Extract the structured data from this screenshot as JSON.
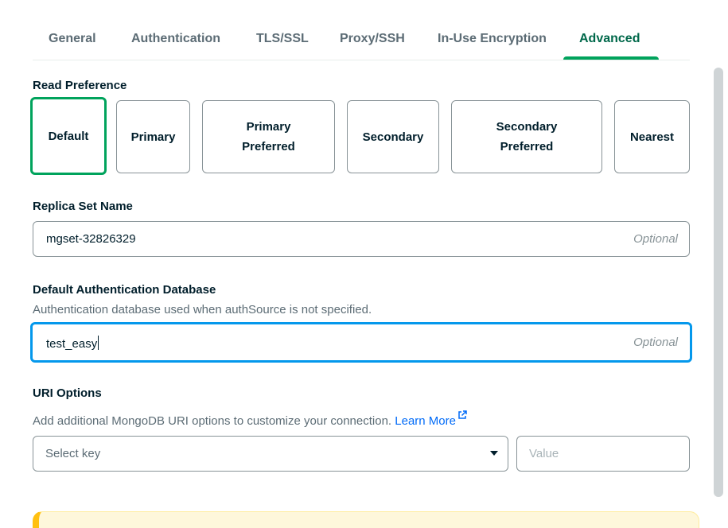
{
  "tabs": [
    {
      "label": "General"
    },
    {
      "label": "Authentication"
    },
    {
      "label": "TLS/SSL"
    },
    {
      "label": "Proxy/SSH"
    },
    {
      "label": "In-Use Encryption"
    },
    {
      "label": "Advanced",
      "active": true
    }
  ],
  "read_preference": {
    "label": "Read Preference",
    "options": [
      {
        "label": "Default",
        "selected": true
      },
      {
        "label": "Primary"
      },
      {
        "label": "Primary Preferred"
      },
      {
        "label": "Secondary"
      },
      {
        "label": "Secondary Preferred"
      },
      {
        "label": "Nearest"
      }
    ]
  },
  "replica_set": {
    "label": "Replica Set Name",
    "value": "mgset-32826329",
    "optional_hint": "Optional"
  },
  "auth_database": {
    "label": "Default Authentication Database",
    "description": "Authentication database used when authSource is not specified.",
    "value": "test_easy",
    "optional_hint": "Optional"
  },
  "uri_options": {
    "label": "URI Options",
    "description": "Add additional MongoDB URI options to customize your connection.",
    "learn_more": "Learn More",
    "key_placeholder": "Select key",
    "value_placeholder": "Value"
  },
  "colors": {
    "accent_green": "#00a35c",
    "focus_blue": "#0498ec",
    "link_blue": "#016bf8",
    "warning_yellow": "#fef7db"
  }
}
